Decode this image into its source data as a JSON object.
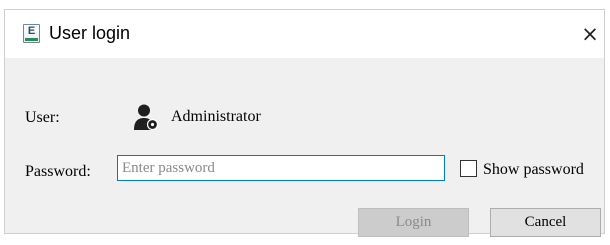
{
  "window": {
    "title": "User login",
    "icon_letter": "E",
    "icon": "app-icon",
    "close_glyph": "×"
  },
  "user": {
    "label": "User:",
    "name": "Administrator",
    "icon": "user-admin-icon"
  },
  "password": {
    "label": "Password:",
    "placeholder": "Enter password",
    "value": ""
  },
  "show_password": {
    "label": "Show password",
    "checked": false
  },
  "buttons": {
    "login": "Login",
    "cancel": "Cancel"
  },
  "colors": {
    "input_focus_border": "#0078d7",
    "dialog_background": "#f0f0f0",
    "disabled_button": "#cccccc"
  }
}
